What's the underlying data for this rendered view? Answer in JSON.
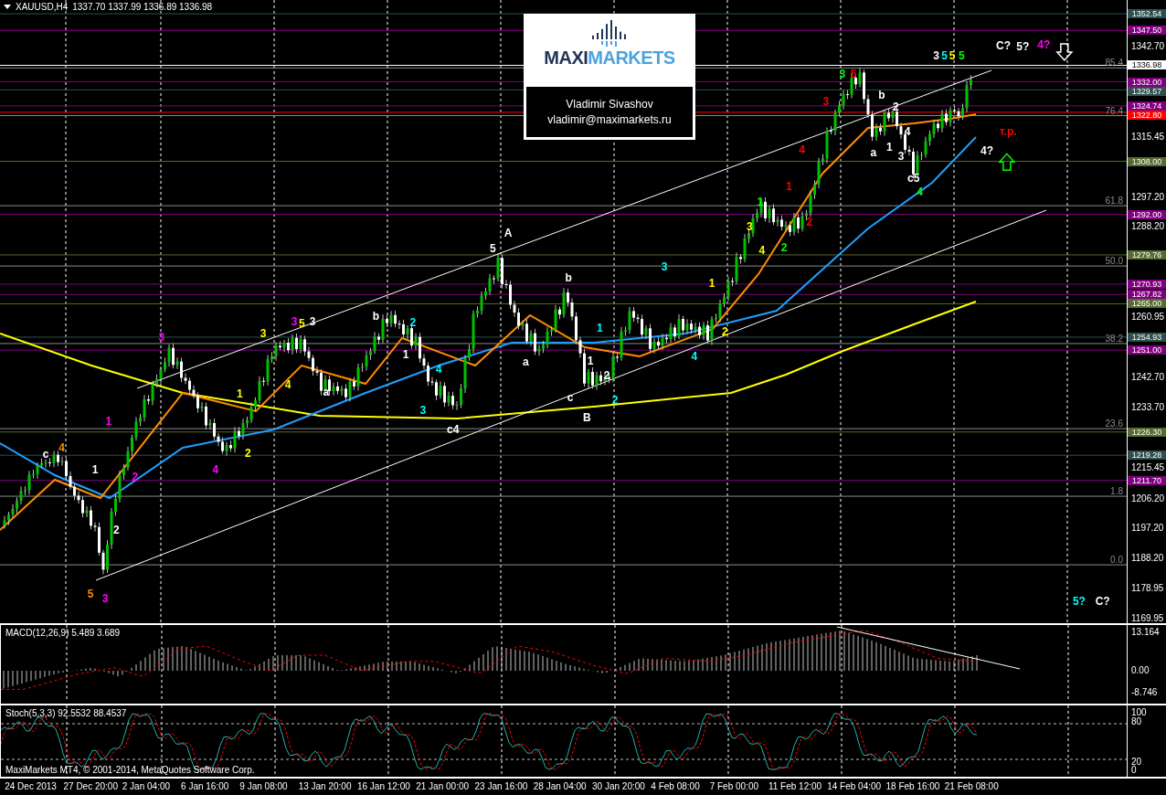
{
  "header": {
    "symbol": "XAUUSD,H4",
    "quote": "1337.70 1337.99 1336.89 1336.98"
  },
  "banner": {
    "logo_dark": "MAXI",
    "logo_light": "MARKETS",
    "author": "Vladimir Sivashov",
    "email": "vladimir@maximarkets.ru"
  },
  "price_chart": {
    "price_axis": [
      "1342.70",
      "1315.45",
      "1297.20",
      "1288.20",
      "1260.95",
      "1242.70",
      "1233.70",
      "1215.45",
      "1206.20",
      "1197.20",
      "1188.20",
      "1178.95",
      "1169.95"
    ],
    "price_tags": [
      {
        "label": "1352.54",
        "color": "#2f4f4f"
      },
      {
        "label": "1347.50",
        "color": "#800080"
      },
      {
        "label": "1336.98",
        "color": "#ffffff"
      },
      {
        "label": "1332.00",
        "color": "#800080"
      },
      {
        "label": "1329.57",
        "color": "#2f4f4f"
      },
      {
        "label": "1324.74",
        "color": "#800080"
      },
      {
        "label": "1322.80",
        "color": "#ff0000"
      },
      {
        "label": "1308.00",
        "color": "#556b2f"
      },
      {
        "label": "1292.00",
        "color": "#800080"
      },
      {
        "label": "1279.76",
        "color": "#556b2f"
      },
      {
        "label": "1270.93",
        "color": "#800080"
      },
      {
        "label": "1267.82",
        "color": "#800080"
      },
      {
        "label": "1265.00",
        "color": "#556b2f"
      },
      {
        "label": "1254.93",
        "color": "#2f4f4f"
      },
      {
        "label": "1251.00",
        "color": "#800080"
      },
      {
        "label": "1226.30",
        "color": "#556b2f"
      },
      {
        "label": "1219.28",
        "color": "#2f4f4f"
      },
      {
        "label": "1211.70",
        "color": "#800080"
      }
    ],
    "fib_labels": [
      "85.4",
      "76.4",
      "61.8",
      "50.0",
      "38.2",
      "23.6",
      "1.8",
      "0.0"
    ],
    "wave_labels": [
      {
        "text": "C?",
        "color": "#ffffff"
      },
      {
        "text": "5?",
        "color": "#ffffff"
      },
      {
        "text": "4?",
        "color": "#ff00ff"
      },
      {
        "text": "3",
        "color": "#ffffff"
      },
      {
        "text": "5",
        "color": "#00ffff"
      },
      {
        "text": "5",
        "color": "#ffff00"
      },
      {
        "text": "5",
        "color": "#00ff00"
      },
      {
        "text": "3",
        "color": "#00ff00"
      },
      {
        "text": "5",
        "color": "#ff0000"
      },
      {
        "text": "3",
        "color": "#ff0000"
      },
      {
        "text": "4",
        "color": "#ff0000"
      },
      {
        "text": "b",
        "color": "#ffffff"
      },
      {
        "text": "2",
        "color": "#ffffff"
      },
      {
        "text": "a",
        "color": "#ffffff"
      },
      {
        "text": "1",
        "color": "#ffffff"
      },
      {
        "text": "4",
        "color": "#ffffff"
      },
      {
        "text": "3",
        "color": "#ffffff"
      },
      {
        "text": "c5",
        "color": "#ffffff"
      },
      {
        "text": "4",
        "color": "#00ff00"
      },
      {
        "text": "4?",
        "color": "#ffffff"
      },
      {
        "text": "т.р.",
        "color": "#ff0000"
      },
      {
        "text": "1",
        "color": "#ff0000"
      },
      {
        "text": "2",
        "color": "#ff0000"
      },
      {
        "text": "1",
        "color": "#00ff00"
      },
      {
        "text": "2",
        "color": "#00ff00"
      },
      {
        "text": "3",
        "color": "#ffff00"
      },
      {
        "text": "4",
        "color": "#ffff00"
      },
      {
        "text": "1",
        "color": "#ffff00"
      },
      {
        "text": "2",
        "color": "#ffff00"
      },
      {
        "text": "3",
        "color": "#00ffff"
      },
      {
        "text": "4",
        "color": "#00ffff"
      },
      {
        "text": "A",
        "color": "#ffffff"
      },
      {
        "text": "5",
        "color": "#ffffff"
      },
      {
        "text": "b",
        "color": "#ffffff"
      },
      {
        "text": "1",
        "color": "#00ffff"
      },
      {
        "text": "a",
        "color": "#ffffff"
      },
      {
        "text": "1",
        "color": "#ffffff"
      },
      {
        "text": "2",
        "color": "#ffffff"
      },
      {
        "text": "c",
        "color": "#ffffff"
      },
      {
        "text": "2",
        "color": "#00ffff"
      },
      {
        "text": "B",
        "color": "#ffffff"
      },
      {
        "text": "b",
        "color": "#ffffff"
      },
      {
        "text": "2",
        "color": "#00ffff"
      },
      {
        "text": "1",
        "color": "#ffffff"
      },
      {
        "text": "4",
        "color": "#00ffff"
      },
      {
        "text": "3",
        "color": "#00ffff"
      },
      {
        "text": "c4",
        "color": "#ffffff"
      },
      {
        "text": "3",
        "color": "#ffff00"
      },
      {
        "text": "3",
        "color": "#ff00ff"
      },
      {
        "text": "5",
        "color": "#ffff00"
      },
      {
        "text": "3",
        "color": "#ffffff"
      },
      {
        "text": "4",
        "color": "#ffff00"
      },
      {
        "text": "1",
        "color": "#ffff00"
      },
      {
        "text": "a",
        "color": "#ffffff"
      },
      {
        "text": "2",
        "color": "#ffff00"
      },
      {
        "text": "4",
        "color": "#ff00ff"
      },
      {
        "text": "1",
        "color": "#ff00ff"
      },
      {
        "text": "2",
        "color": "#ff00ff"
      },
      {
        "text": "3",
        "color": "#ff00ff"
      },
      {
        "text": "c",
        "color": "#ffffff"
      },
      {
        "text": "4",
        "color": "#ff8c00"
      },
      {
        "text": "1",
        "color": "#ffffff"
      },
      {
        "text": "2",
        "color": "#ffffff"
      },
      {
        "text": "5",
        "color": "#ff8c00"
      },
      {
        "text": "3",
        "color": "#ff00ff"
      },
      {
        "text": "5?",
        "color": "#00ffff"
      },
      {
        "text": "C?",
        "color": "#ffffff"
      }
    ]
  },
  "macd": {
    "label": "MACD(12,26,9) 5.489 3.689",
    "scale": [
      "13.164",
      "0.00",
      "-8.746"
    ]
  },
  "stochastic": {
    "label": "Stoch(5,3,3) 92.5532 88.4537",
    "scale": [
      "100",
      "80",
      "20",
      "0"
    ],
    "copyright": "MaxiMarkets MT4, © 2001-2014, MetaQuotes Software Corp."
  },
  "time_axis": [
    "24 Dec 2013",
    "27 Dec 20:00",
    "2 Jan 04:00",
    "6 Jan 16:00",
    "9 Jan 08:00",
    "13 Jan 20:00",
    "16 Jan 12:00",
    "21 Jan 00:00",
    "23 Jan 16:00",
    "28 Jan 04:00",
    "30 Jan 20:00",
    "4 Feb 08:00",
    "7 Feb 00:00",
    "11 Feb 12:00",
    "14 Feb 04:00",
    "18 Feb 16:00",
    "21 Feb 08:00"
  ]
}
